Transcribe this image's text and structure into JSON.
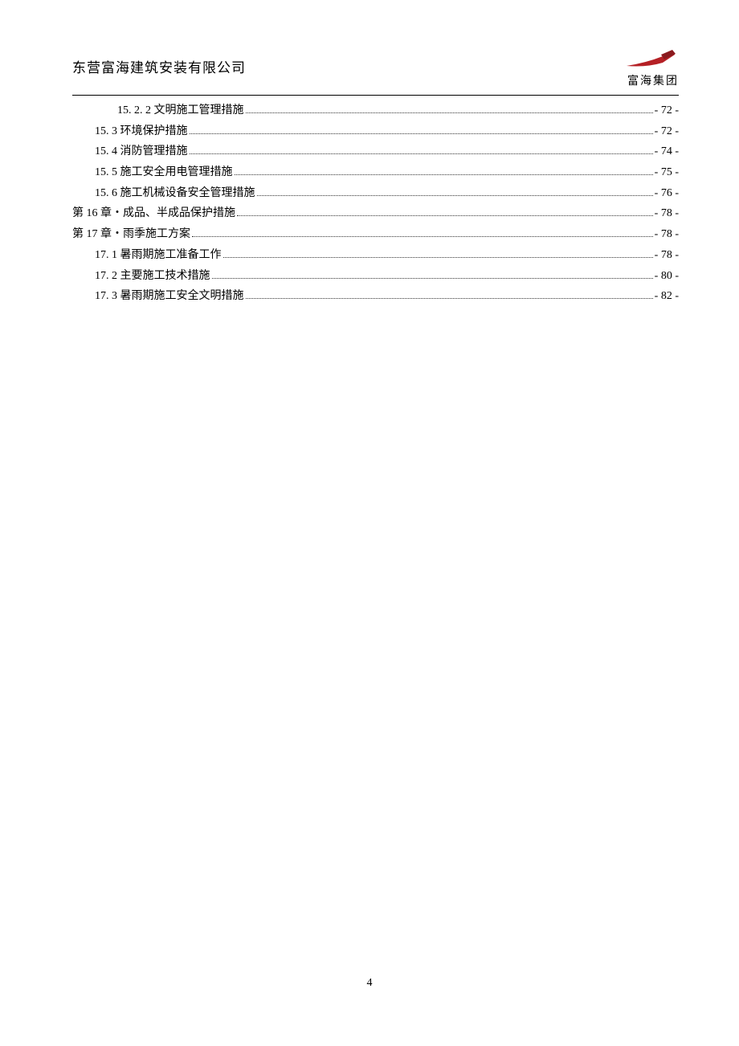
{
  "header": {
    "company": "东营富海建筑安装有限公司",
    "logo_text": "富海集团"
  },
  "toc": [
    {
      "indent": 2,
      "label": "15. 2. 2 文明施工管理措施",
      "page": "- 72 -"
    },
    {
      "indent": 1,
      "label": "15. 3 环境保护措施",
      "page": "- 72 -"
    },
    {
      "indent": 1,
      "label": "15. 4 消防管理措施",
      "page": "- 74 -"
    },
    {
      "indent": 1,
      "label": "15. 5 施工安全用电管理措施",
      "page": "- 75 -"
    },
    {
      "indent": 1,
      "label": "15. 6 施工机械设备安全管理措施",
      "page": "- 76 -"
    },
    {
      "indent": 0,
      "label": "第 16 章・成品、半成品保护措施",
      "page": "- 78 -"
    },
    {
      "indent": 0,
      "label": "第 17 章・雨季施工方案",
      "page": "- 78 -"
    },
    {
      "indent": 1,
      "label": "17. 1 暑雨期施工准备工作",
      "page": "- 78 -"
    },
    {
      "indent": 1,
      "label": "17. 2 主要施工技术措施",
      "page": "- 80 -"
    },
    {
      "indent": 1,
      "label": "17. 3 暑雨期施工安全文明措施",
      "page": "- 82 -"
    }
  ],
  "footer": {
    "page_number": "4"
  }
}
